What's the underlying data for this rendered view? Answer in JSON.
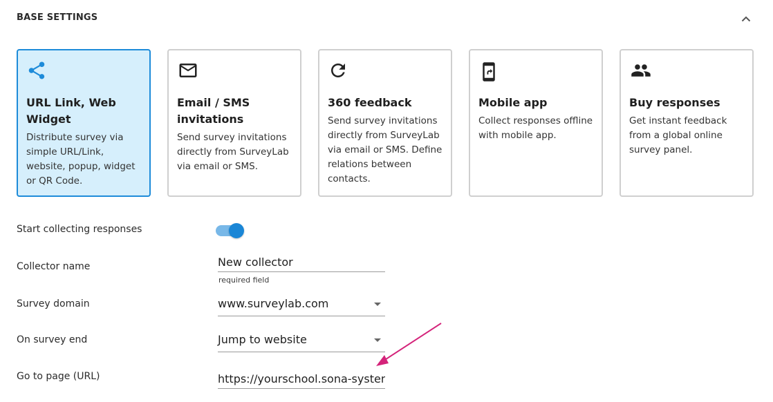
{
  "section": {
    "title": "BASE SETTINGS"
  },
  "cards": [
    {
      "title": "URL Link, Web Widget",
      "description": "Distribute survey via simple URL/Link, website, popup, widget or QR Code.",
      "icon": "share-icon",
      "selected": true
    },
    {
      "title": "Email / SMS invitations",
      "description": "Send survey invitations directly from SurveyLab via email or SMS.",
      "icon": "mail-icon",
      "selected": false
    },
    {
      "title": "360 feedback",
      "description": "Send survey invitations directly from SurveyLab via email or SMS. Define relations between contacts.",
      "icon": "refresh-icon",
      "selected": false
    },
    {
      "title": "Mobile app",
      "description": "Collect responses offline with mobile app.",
      "icon": "mobile-icon",
      "selected": false
    },
    {
      "title": "Buy responses",
      "description": "Get instant feedback from a global online survey panel.",
      "icon": "people-icon",
      "selected": false
    }
  ],
  "form": {
    "start_collecting": {
      "label": "Start collecting responses",
      "enabled": true
    },
    "collector_name": {
      "label": "Collector name",
      "value": "New collector",
      "helper": "required field"
    },
    "survey_domain": {
      "label": "Survey domain",
      "value": "www.surveylab.com"
    },
    "on_survey_end": {
      "label": "On survey end",
      "value": "Jump to website"
    },
    "go_to_page": {
      "label": "Go to page (URL)",
      "value": "https://yourschool.sona-system"
    }
  },
  "colors": {
    "accent": "#1d8bd9",
    "selected_card_bg": "#d6effc",
    "annotation_arrow": "#d4237a"
  }
}
